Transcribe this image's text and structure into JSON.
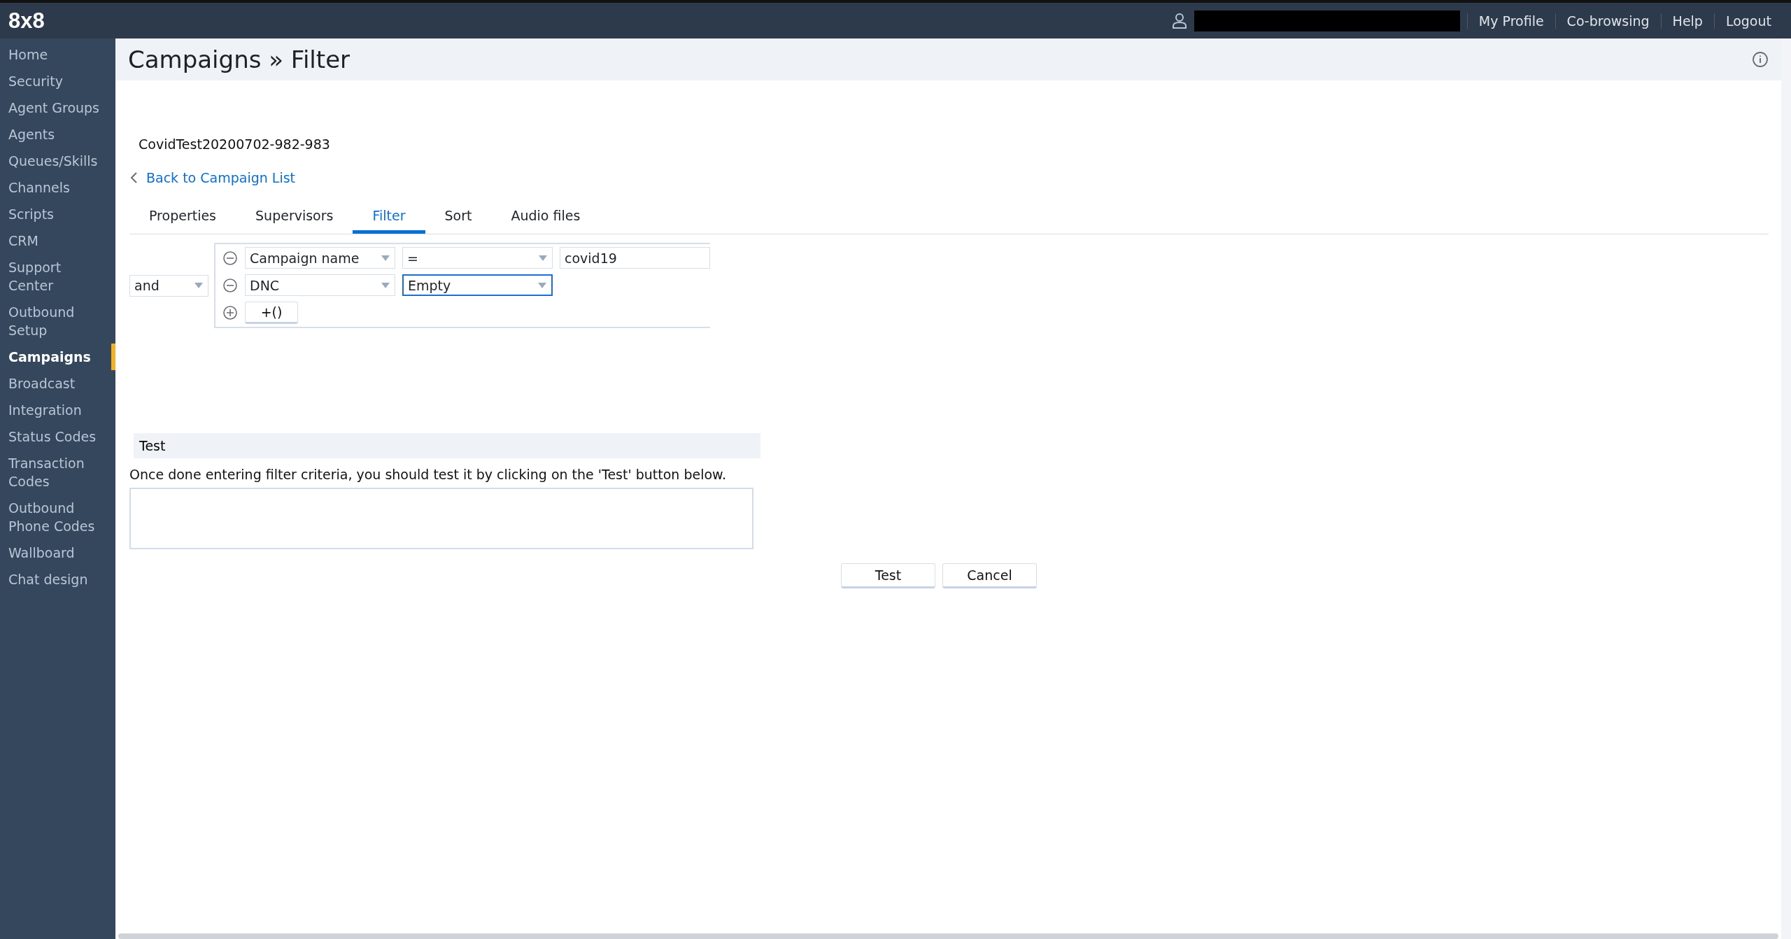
{
  "topbar": {
    "logo": "8x8",
    "links": [
      {
        "label": "My Profile"
      },
      {
        "label": "Co-browsing"
      },
      {
        "label": "Help"
      },
      {
        "label": "Logout"
      }
    ]
  },
  "sidebar": {
    "items": [
      {
        "label": "Home",
        "selected": false
      },
      {
        "label": "Security",
        "selected": false
      },
      {
        "label": "Agent Groups",
        "selected": false
      },
      {
        "label": "Agents",
        "selected": false
      },
      {
        "label": "Queues/Skills",
        "selected": false
      },
      {
        "label": "Channels",
        "selected": false
      },
      {
        "label": "Scripts",
        "selected": false
      },
      {
        "label": "CRM",
        "selected": false
      },
      {
        "label": "Support Center",
        "selected": false
      },
      {
        "label": "Outbound Setup",
        "selected": false
      },
      {
        "label": "Campaigns",
        "selected": true
      },
      {
        "label": "Broadcast",
        "selected": false
      },
      {
        "label": "Integration",
        "selected": false
      },
      {
        "label": "Status Codes",
        "selected": false
      },
      {
        "label": "Transaction Codes",
        "selected": false
      },
      {
        "label": "Outbound Phone Codes",
        "selected": false
      },
      {
        "label": "Wallboard",
        "selected": false
      },
      {
        "label": "Chat design",
        "selected": false
      }
    ]
  },
  "page": {
    "title": "Campaigns » Filter",
    "campaign_name": "CovidTest20200702-982-983",
    "back_link": "Back to Campaign List"
  },
  "tabs": [
    {
      "label": "Properties",
      "selected": false
    },
    {
      "label": "Supervisors",
      "selected": false
    },
    {
      "label": "Filter",
      "selected": true
    },
    {
      "label": "Sort",
      "selected": false
    },
    {
      "label": "Audio files",
      "selected": false
    }
  ],
  "filter": {
    "operator": "and",
    "conditions": [
      {
        "field": "Campaign name",
        "comparison": "=",
        "value": "covid19",
        "focused": false
      },
      {
        "field": "DNC",
        "comparison": "Empty",
        "focused": true
      }
    ],
    "group_button": "+()"
  },
  "test": {
    "heading": "Test",
    "instructions": "Once done entering filter criteria, you should test it by clicking on the 'Test' button below."
  },
  "buttons": [
    {
      "label": "Test"
    },
    {
      "label": "Cancel"
    }
  ]
}
